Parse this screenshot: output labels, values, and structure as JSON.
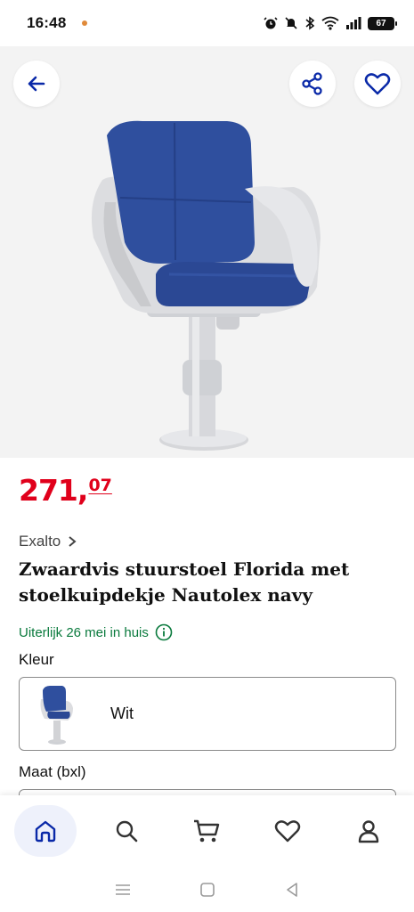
{
  "status_bar": {
    "time": "16:48",
    "battery": "67",
    "icons": [
      "alarm-icon",
      "mute-icon",
      "bluetooth-icon",
      "wifi-icon",
      "signal-icon",
      "battery-icon"
    ]
  },
  "header": {
    "back_icon": "arrow-left-icon",
    "share_icon": "share-icon",
    "favorite_icon": "heart-icon"
  },
  "product": {
    "price_main": "271",
    "price_sep": ",",
    "price_cents": "07",
    "brand": "Exalto",
    "title": "Zwaardvis stuurstoel Florida met stoelkuipdekje Nautolex navy",
    "delivery": "Uiterlijk 26 mei in huis",
    "color_label": "Kleur",
    "color_value": "Wit",
    "size_label": "Maat (bxl)"
  },
  "bottom_nav": {
    "items": [
      "home-icon",
      "search-icon",
      "cart-icon",
      "heart-icon",
      "account-icon"
    ]
  },
  "colors": {
    "accent": "#0a29a8",
    "price": "#e0001b",
    "delivery": "#0a7a3d",
    "seat_blue": "#2f4f9e",
    "shell_grey": "#dcdde0"
  }
}
